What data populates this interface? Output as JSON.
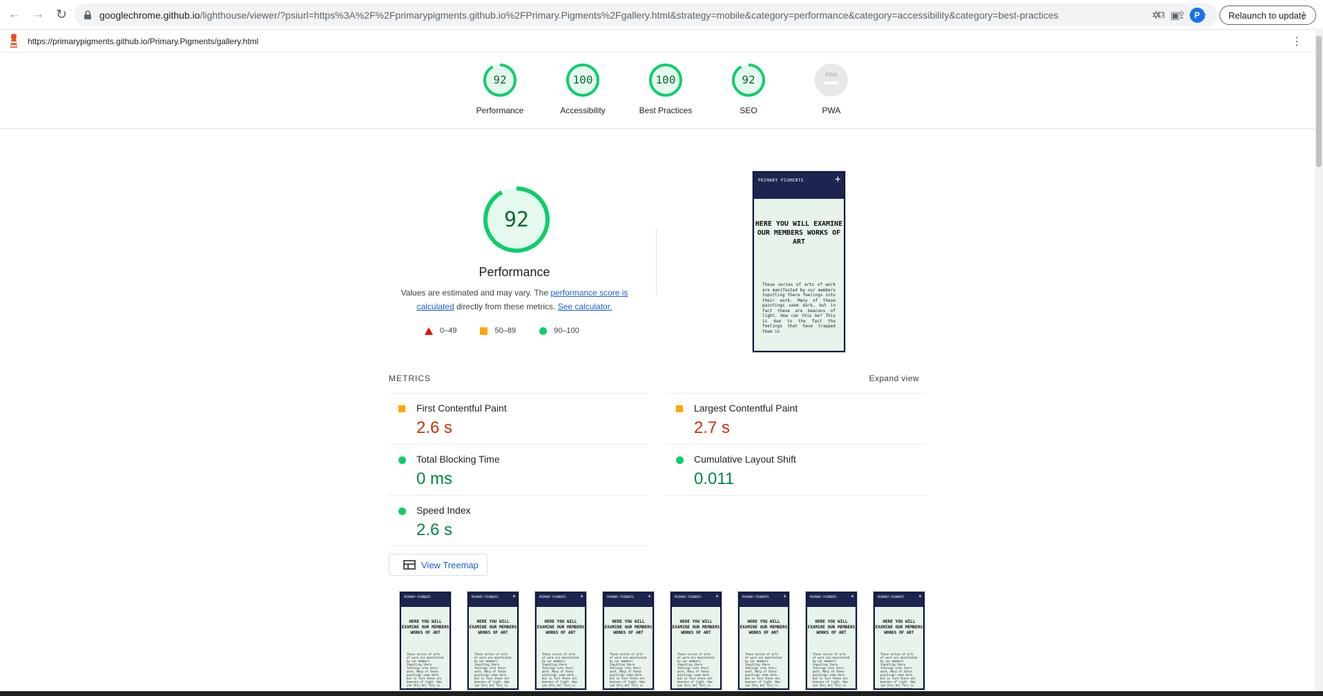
{
  "browser": {
    "url_domain": "googlechrome.github.io",
    "url_rest": "/lighthouse/viewer/?psiurl=https%3A%2F%2Fprimarypigments.github.io%2FPrimary.Pigments%2Fgallery.html&strategy=mobile&category=performance&category=accessibility&category=best-practices...",
    "avatar_letter": "P",
    "relaunch_label": "Relaunch to update"
  },
  "lighthouse": {
    "report_url": "https://primarypigments.github.io/Primary.Pigments/gallery.html"
  },
  "categories": [
    {
      "label": "Performance",
      "score": "92"
    },
    {
      "label": "Accessibility",
      "score": "100"
    },
    {
      "label": "Best Practices",
      "score": "100"
    },
    {
      "label": "SEO",
      "score": "92"
    },
    {
      "label": "PWA",
      "score": "PWA"
    }
  ],
  "performance": {
    "score": "92",
    "score_fraction": 0.92,
    "title": "Performance",
    "desc_pre": "Values are estimated and may vary. The ",
    "desc_link1": "performance score is calculated",
    "desc_mid": " directly from these metrics. ",
    "desc_link2": "See calculator.",
    "legend": [
      "0–49",
      "50–89",
      "90–100"
    ]
  },
  "screenshot": {
    "header": "PRIMARY PIGMENTS",
    "title": "HERE YOU WILL EXAMINE OUR MEMBERS WORKS OF ART",
    "body": "These series of arts of work are manifested by our members Inputting there feelings into their work. Many of these paintings seem dark, but in fact these are beacons of light. How can this be? This is due to the fact the feelings that have trapped them in"
  },
  "metrics": {
    "title": "METRICS",
    "expand_label": "Expand view",
    "items": [
      {
        "name": "First Contentful Paint",
        "value": "2.6 s",
        "status": "average"
      },
      {
        "name": "Largest Contentful Paint",
        "value": "2.7 s",
        "status": "average"
      },
      {
        "name": "Total Blocking Time",
        "value": "0 ms",
        "status": "pass"
      },
      {
        "name": "Cumulative Layout Shift",
        "value": "0.011",
        "status": "pass"
      },
      {
        "name": "Speed Index",
        "value": "2.6 s",
        "status": "pass"
      }
    ]
  },
  "treemap_label": "View Treemap",
  "colors": {
    "pass": "#0cce6b",
    "average": "#ffa400",
    "fail": "#eb0f00",
    "pass_text": "#018642",
    "average_text": "#c33300",
    "link": "#1a5ccf"
  }
}
